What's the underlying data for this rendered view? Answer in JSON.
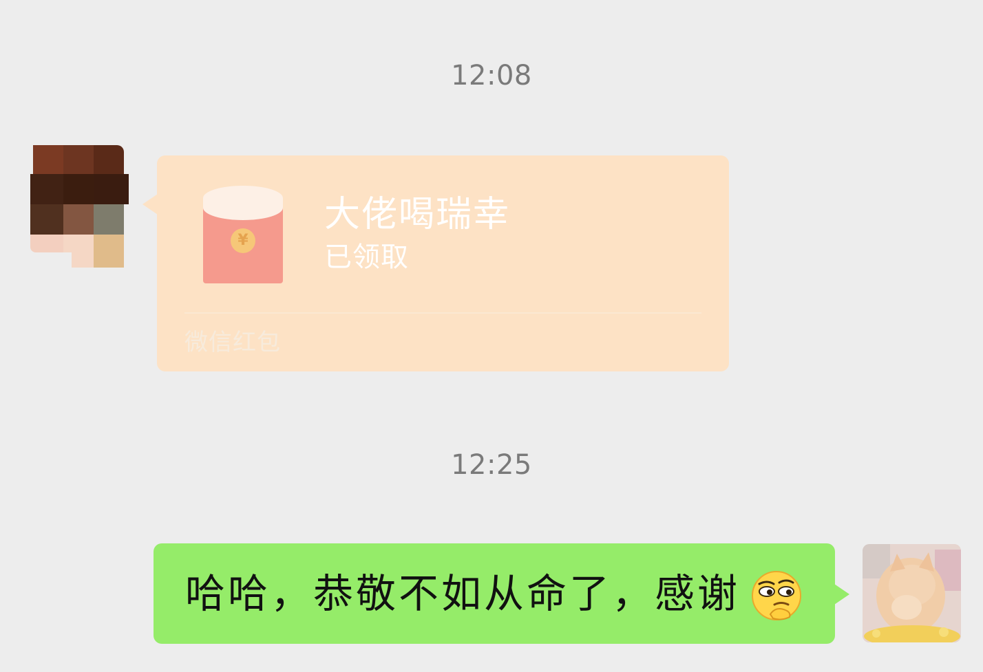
{
  "chat": {
    "messages": [
      {
        "timestamp": "12:08",
        "sender": "other",
        "type": "red_packet",
        "red_packet": {
          "title": "大佬喝瑞幸",
          "status": "已领取",
          "footer": "微信红包",
          "coin_symbol": "¥"
        }
      },
      {
        "timestamp": "12:25",
        "sender": "self",
        "type": "text",
        "text": "哈哈，恭敬不如从命了，感谢",
        "emoji": "smirk-thinking-emoji"
      }
    ]
  },
  "colors": {
    "background": "#ededed",
    "red_packet_bubble": "#fde2c5",
    "self_bubble": "#95ec69",
    "timestamp_text": "#7a7a7a"
  }
}
